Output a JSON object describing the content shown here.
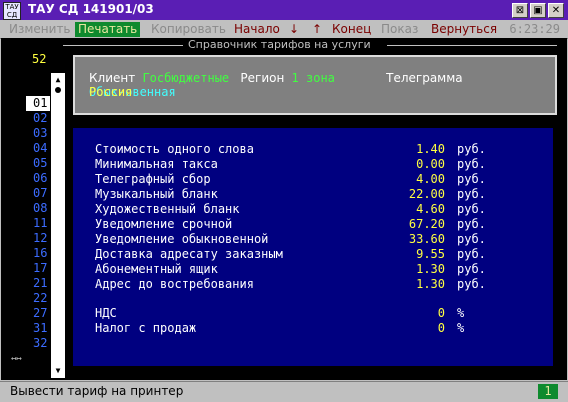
{
  "window": {
    "title": "ТАУ СД 141901/03",
    "icon_text": "ТАУ\nСД"
  },
  "menu": [
    {
      "label": "Изменить",
      "state": "disabled"
    },
    {
      "label": "Печатать",
      "state": "selected"
    },
    {
      "label": "Копировать",
      "state": "disabled"
    },
    {
      "label": "Начало",
      "state": "active"
    },
    {
      "label": "↓",
      "state": "active"
    },
    {
      "label": "↑",
      "state": "active"
    },
    {
      "label": "Конец",
      "state": "active"
    },
    {
      "label": "Показ",
      "state": "disabled"
    },
    {
      "label": "Вернуться",
      "state": "active"
    }
  ],
  "clock": "6:23:29",
  "frame_title": "Справочник тарифов на услуги",
  "count": "52",
  "codes": [
    "01",
    "02",
    "03",
    "04",
    "05",
    "06",
    "07",
    "08",
    "11",
    "12",
    "16",
    "17",
    "21",
    "22",
    "27",
    "31",
    "32"
  ],
  "selected_code": "01",
  "info": {
    "client_label": "Клиент",
    "client_value": "Госбюджетные",
    "region_label": "Регион",
    "region_value": "1 зона",
    "type_value": "Телеграмма",
    "kind_value": "Обыкновенная",
    "country_value": "Россия"
  },
  "tariffs": [
    {
      "name": "Стоимость одного слова",
      "value": "1.40",
      "unit": "руб."
    },
    {
      "name": "Минимальная такса",
      "value": "0.00",
      "unit": "руб."
    },
    {
      "name": "Телеграфный сбор",
      "value": "4.00",
      "unit": "руб."
    },
    {
      "name": "Музыкальный бланк",
      "value": "22.00",
      "unit": "руб."
    },
    {
      "name": "Художественный бланк",
      "value": "4.60",
      "unit": "руб."
    },
    {
      "name": "Уведомление срочной",
      "value": "67.20",
      "unit": "руб."
    },
    {
      "name": "Уведомление обыкновенной",
      "value": "33.60",
      "unit": "руб."
    },
    {
      "name": "Доставка адресату заказным",
      "value": "9.55",
      "unit": "руб."
    },
    {
      "name": "Абонементный ящик",
      "value": "1.30",
      "unit": "руб."
    },
    {
      "name": "Адрес до востребования",
      "value": "1.30",
      "unit": "руб."
    }
  ],
  "taxes": [
    {
      "name": "НДС",
      "value": "0",
      "unit": "%"
    },
    {
      "name": "Налог с продаж",
      "value": "0",
      "unit": "%"
    }
  ],
  "status": {
    "text": "Вывести тариф на принтер",
    "count": "1"
  },
  "colors": {
    "titlebar": "#5a1eb4",
    "panel_bg": "#000080",
    "accent_green": "#0e8a2e",
    "code_blue": "#3c6cff",
    "value_yellow": "#ffff40"
  }
}
